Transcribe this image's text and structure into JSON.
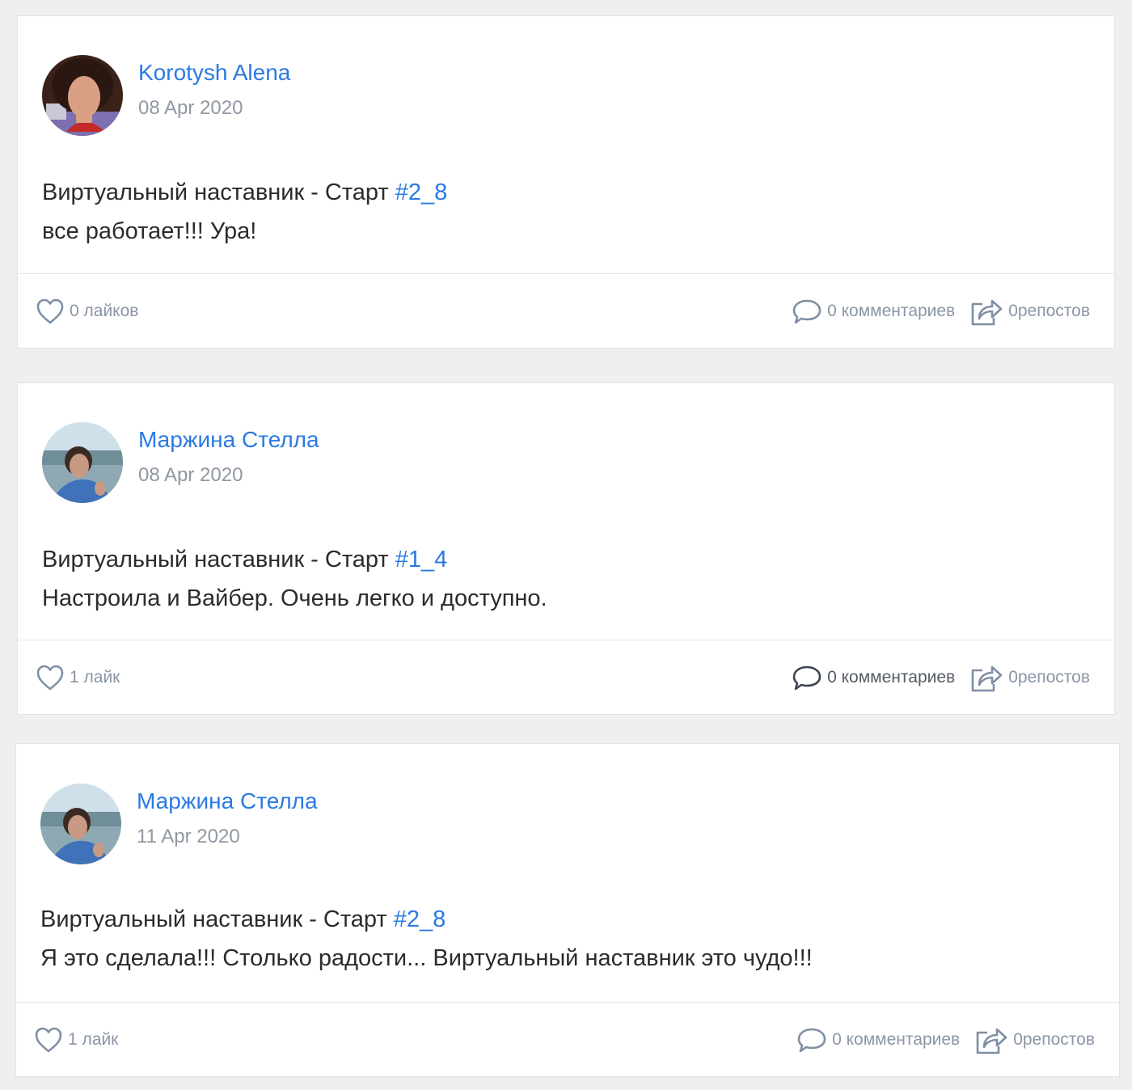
{
  "posts": [
    {
      "author": "Korotysh Alena",
      "date": "08 Apr 2020",
      "title_text": "Виртуальный наставник - Старт ",
      "hashtag": "#2_8",
      "body": "все работает!!! Ура!",
      "likes": "0 лайков",
      "comments": "0 комментариев",
      "reposts": "0репостов"
    },
    {
      "author": "Маржина Стелла",
      "date": "08 Apr 2020",
      "title_text": "Виртуальный наставник - Старт ",
      "hashtag": "#1_4",
      "body": "Настроила и Вайбер. Очень легко и доступно.",
      "likes": "1 лайк",
      "comments": "0 комментариев",
      "reposts": "0репостов"
    },
    {
      "author": "Маржина Стелла",
      "date": "11 Apr 2020",
      "title_text": "Виртуальный наставник - Старт ",
      "hashtag": "#2_8",
      "body": "Я это сделала!!! Столько радости... Виртуальный наставник это чудо!!!",
      "likes": "1 лайк",
      "comments": "0 комментариев",
      "reposts": "0репостов"
    }
  ],
  "colors": {
    "link": "#2a7ae2",
    "muted": "#9098a3",
    "icon": "#7f8fa4",
    "background": "#efefef"
  },
  "icons": {
    "like": "heart-icon",
    "comment": "comment-bubble-icon",
    "repost": "share-icon"
  }
}
